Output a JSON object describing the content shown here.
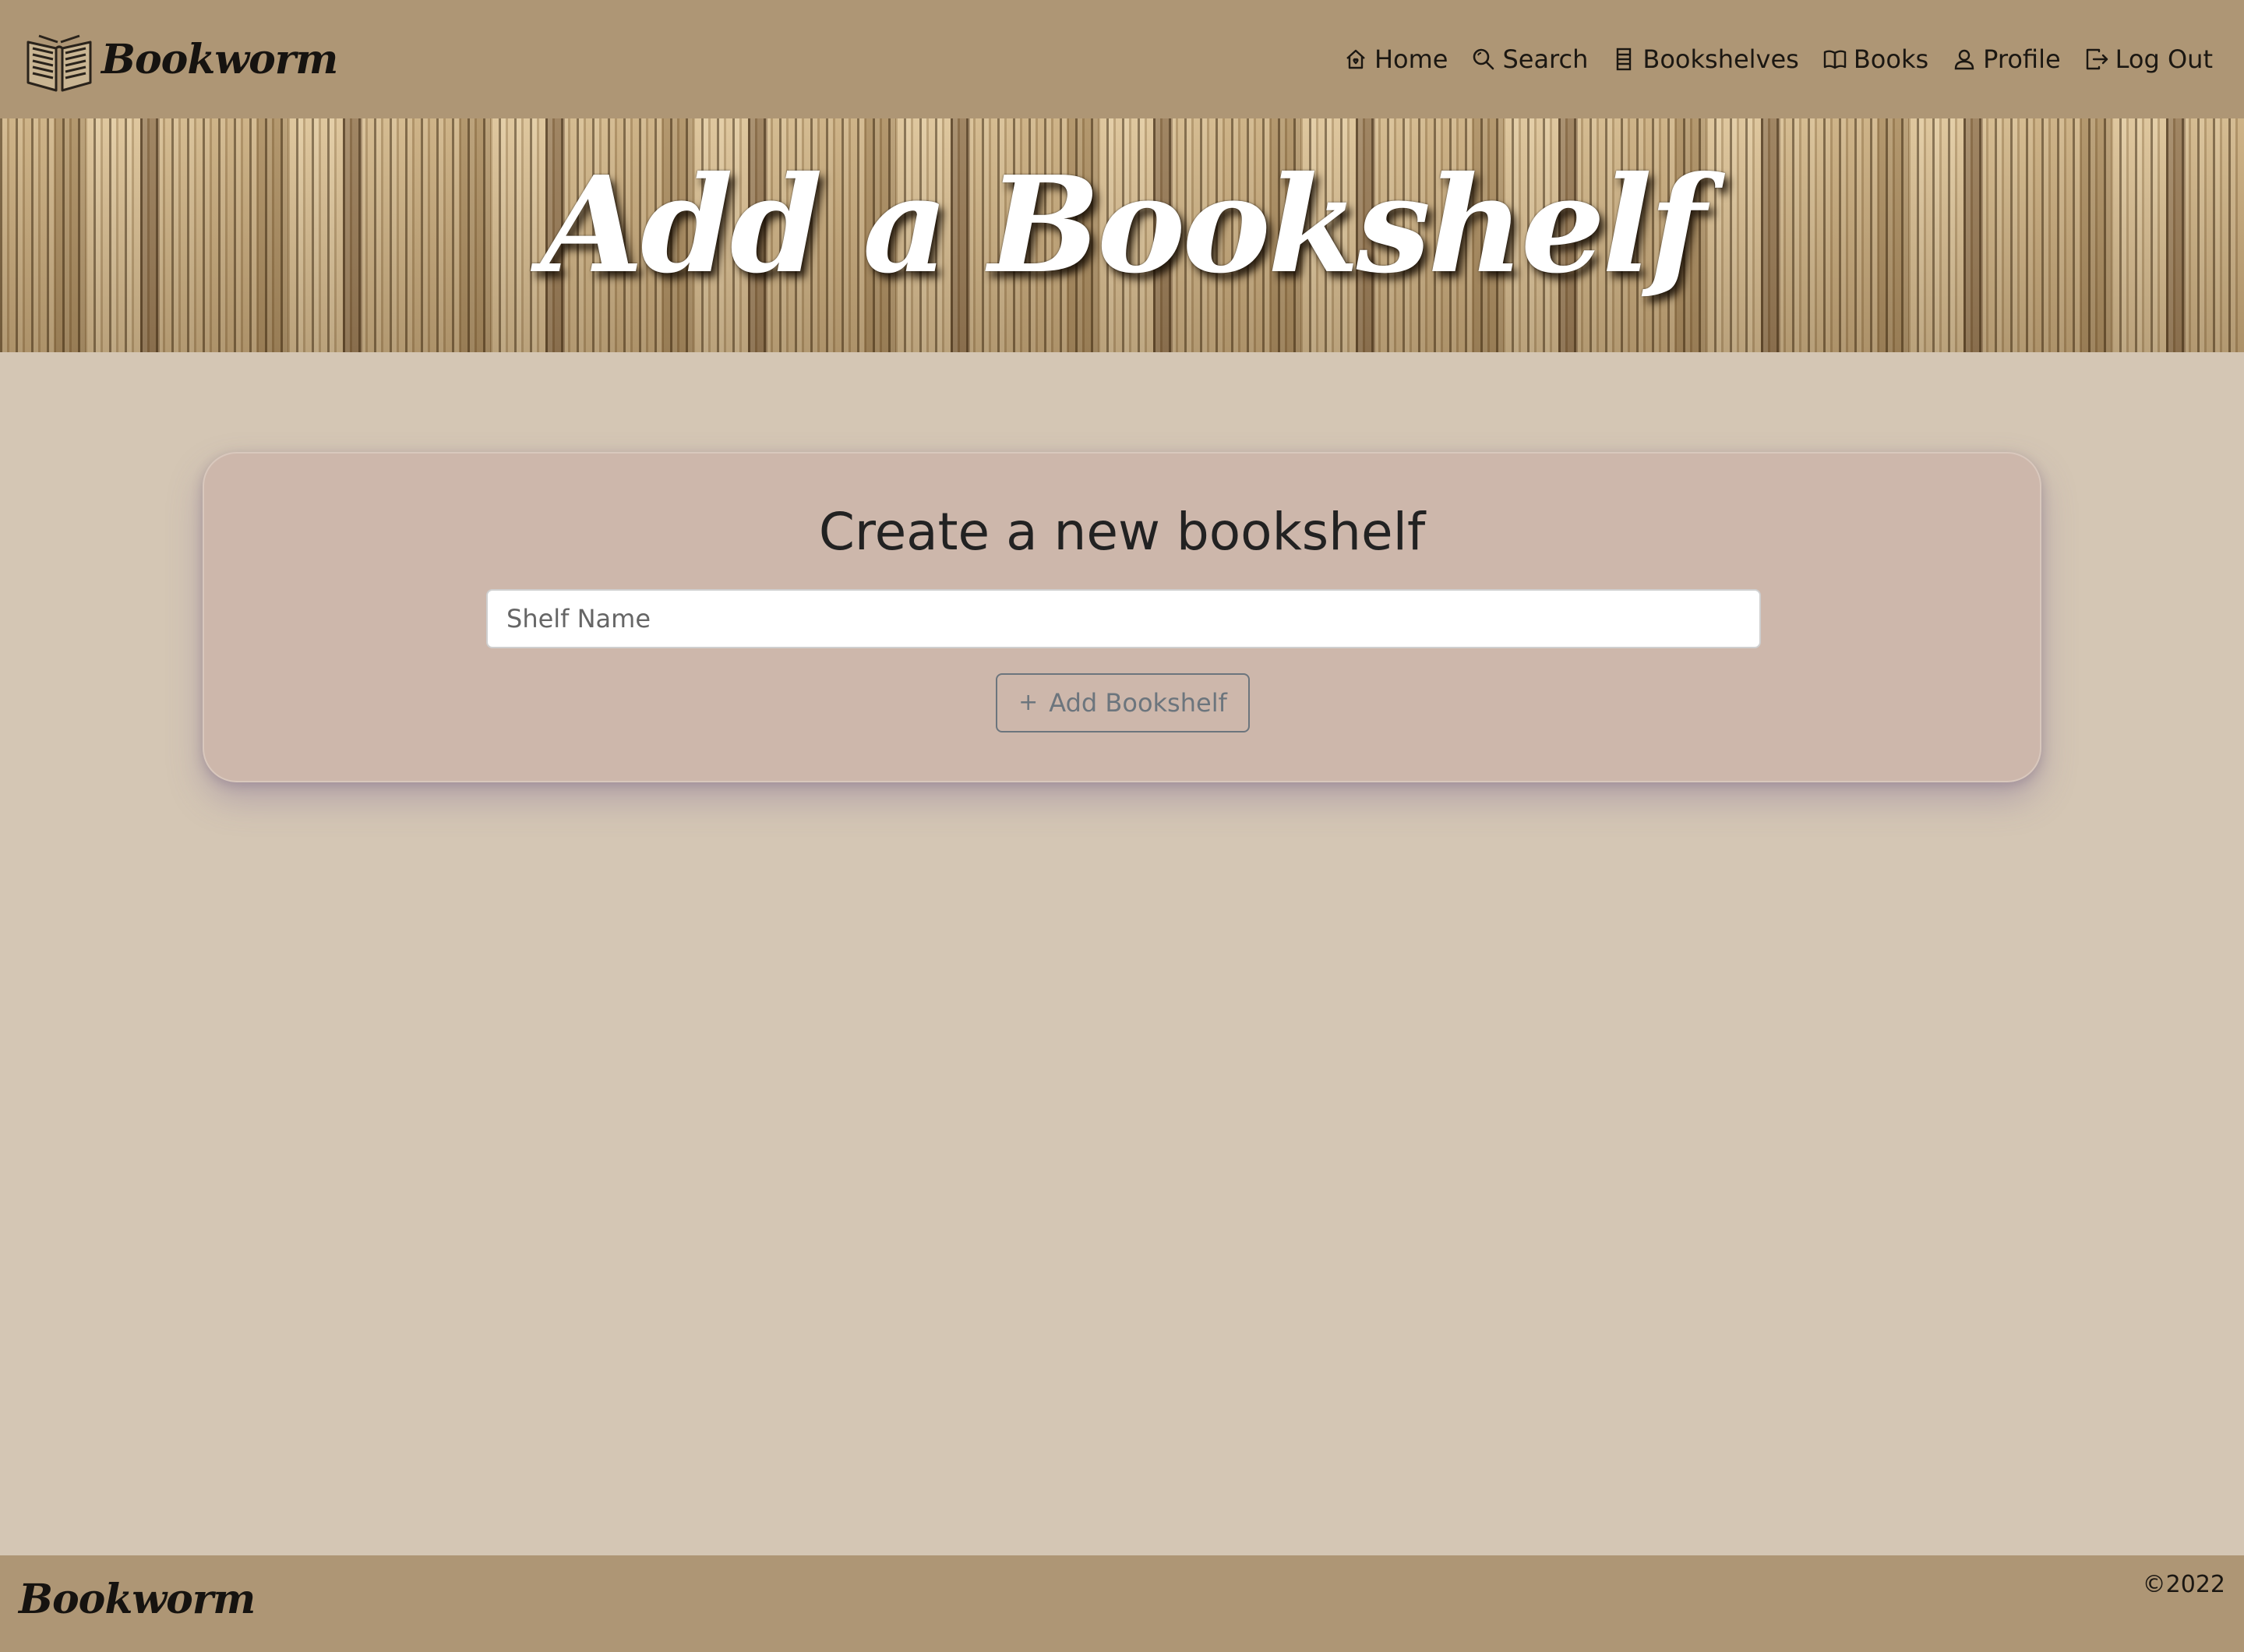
{
  "navbar": {
    "brand": "Bookworm",
    "items": [
      {
        "label": "Home",
        "icon": "home-icon"
      },
      {
        "label": "Search",
        "icon": "search-icon"
      },
      {
        "label": "Bookshelves",
        "icon": "bookshelves-icon"
      },
      {
        "label": "Books",
        "icon": "book-icon"
      },
      {
        "label": "Profile",
        "icon": "profile-icon"
      },
      {
        "label": "Log Out",
        "icon": "logout-icon"
      }
    ]
  },
  "hero": {
    "title": "Add a Bookshelf"
  },
  "form": {
    "heading": "Create a new bookshelf",
    "shelf_name_placeholder": "Shelf Name",
    "shelf_name_value": "",
    "submit_label": "Add Bookshelf",
    "submit_icon": "plus-icon"
  },
  "footer": {
    "brand": "Bookworm",
    "copyright": "©2022"
  },
  "colors": {
    "navbar_bg": "#ae9675",
    "page_bg": "#d4c6b4",
    "card_bg": "#cdb7ab",
    "button_outline": "#6c757d"
  }
}
